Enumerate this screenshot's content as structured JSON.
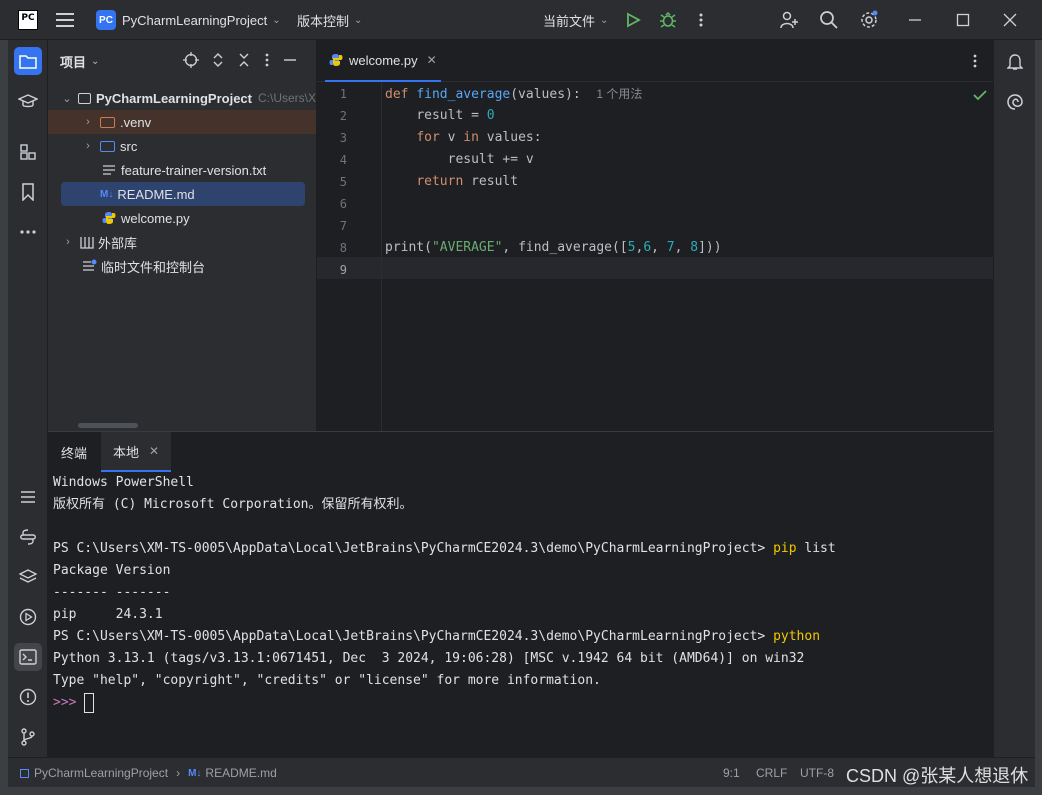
{
  "titlebar": {
    "logo_text": "PC",
    "project_badge": "PC",
    "project_name": "PyCharmLearningProject",
    "vcs_menu": "版本控制",
    "run_config": "当前文件"
  },
  "project_panel": {
    "title": "项目",
    "items": [
      {
        "label": "PyCharmLearningProject",
        "path": "C:\\Users\\X"
      },
      {
        "label": ".venv"
      },
      {
        "label": "src"
      },
      {
        "label": "feature-trainer-version.txt"
      },
      {
        "label": "README.md"
      },
      {
        "label": "welcome.py"
      },
      {
        "label": "外部库"
      },
      {
        "label": "临时文件和控制台"
      }
    ]
  },
  "editor": {
    "tab_label": "welcome.py",
    "usage_hint": "1 个用法",
    "line_numbers": [
      "1",
      "2",
      "3",
      "4",
      "5",
      "6",
      "7",
      "8",
      "9"
    ],
    "code": {
      "l1_def": "def",
      "l1_fn": "find_average",
      "l1_rest": "(values):",
      "l2_a": "result = ",
      "l2_b": "0",
      "l3_for": "for",
      "l3_v": " v ",
      "l3_in": "in",
      "l3_rest": " values:",
      "l4": "result += v",
      "l5_kw": "return",
      "l5_rest": " result",
      "l8_print": "print(",
      "l8_str": "\"AVERAGE\"",
      "l8_mid": ", find_average([",
      "l8_n1": "5",
      "l8_c1": ",",
      "l8_n2": "6",
      "l8_c2": ", ",
      "l8_n3": "7",
      "l8_c3": ", ",
      "l8_n4": "8",
      "l8_end": "]))"
    }
  },
  "terminal": {
    "tab_title": "终端",
    "tab_local": "本地",
    "lines": {
      "l1": "Windows PowerShell",
      "l2": "版权所有 (C) Microsoft Corporation。保留所有权利。",
      "l3_prompt": "PS C:\\Users\\XM-TS-0005\\AppData\\Local\\JetBrains\\PyCharmCE2024.3\\demo\\PyCharmLearningProject> ",
      "l3_cmd": "pip",
      "l3_rest": " list",
      "l4": "Package Version",
      "l5": "------- -------",
      "l6": "pip     24.3.1",
      "l7_prompt": "PS C:\\Users\\XM-TS-0005\\AppData\\Local\\JetBrains\\PyCharmCE2024.3\\demo\\PyCharmLearningProject> ",
      "l7_cmd": "python",
      "l8": "Python 3.13.1 (tags/v3.13.1:0671451, Dec  3 2024, 19:06:28) [MSC v.1942 64 bit (AMD64)] on win32",
      "l9": "Type \"help\", \"copyright\", \"credits\" or \"license\" for more information.",
      "l10_prompt": ">>>"
    }
  },
  "statusbar": {
    "crumb_project": "PyCharmLearningProject",
    "crumb_file": "README.md",
    "position": "9:1",
    "line_sep": "CRLF",
    "encoding": "UTF-8"
  },
  "watermark": "CSDN @张某人想退休",
  "colors": {
    "accent": "#3574f0",
    "keyword": "#cf8e6d",
    "function": "#56a8f5",
    "number": "#2aacb8",
    "string": "#6aab73",
    "run_green": "#5fb865"
  }
}
